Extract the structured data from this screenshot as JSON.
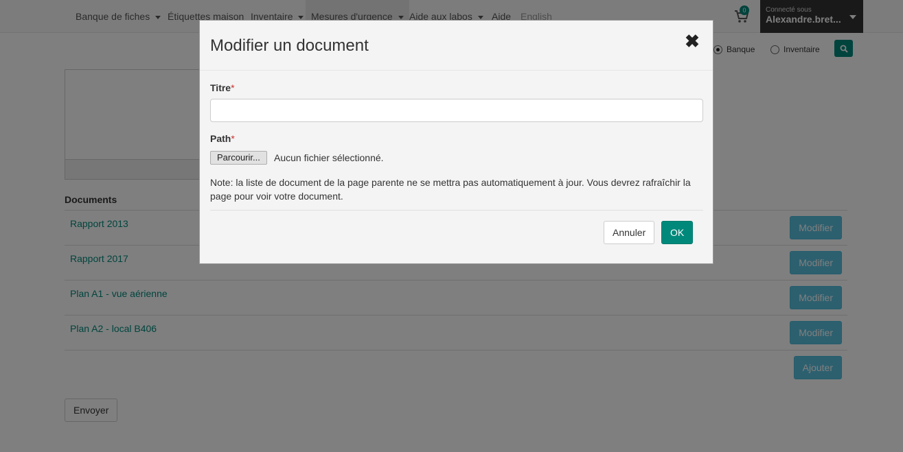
{
  "navbar": {
    "items": [
      {
        "label": "Banque de fiches",
        "dropdown": true
      },
      {
        "label": "Étiquettes maison",
        "dropdown": false
      },
      {
        "label": "Inventaire",
        "dropdown": true
      },
      {
        "label": "Mesures d'urgence",
        "dropdown": true
      },
      {
        "label": "Aide aux labos",
        "dropdown": true
      },
      {
        "label": "Aide",
        "dropdown": false
      },
      {
        "label": "English",
        "dropdown": false
      }
    ],
    "cart_count": "0",
    "user": {
      "connected_label": "Connecté sous",
      "name": "Alexandre.bret..."
    }
  },
  "search": {
    "options": [
      {
        "label": "Banque",
        "checked": true
      },
      {
        "label": "Inventaire",
        "checked": false
      }
    ]
  },
  "documents": {
    "title": "Documents",
    "items": [
      {
        "name": "Rapport 2013",
        "action": "Modifier"
      },
      {
        "name": "Rapport 2017",
        "action": "Modifier"
      },
      {
        "name": "Plan A1 - vue aérienne",
        "action": "Modifier"
      },
      {
        "name": "Plan A2 - local B406",
        "action": "Modifier"
      }
    ],
    "add_label": "Ajouter"
  },
  "send_label": "Envoyer",
  "modal": {
    "title": "Modifier un document",
    "close_symbol": "✖",
    "fields": {
      "title_label": "Titre",
      "title_value": "",
      "path_label": "Path",
      "required_marker": "*",
      "browse_label": "Parcourir...",
      "file_status": "Aucun fichier sélectionné."
    },
    "note": "Note: la liste de document de la page parente ne se mettra pas automatiquement à jour. Vous devrez rafraîchir la page pour voir votre document.",
    "cancel_label": "Annuler",
    "ok_label": "OK"
  },
  "colors": {
    "accent": "#00897b",
    "info": "#5bc0de",
    "backdrop": "rgba(0,0,0,0.5)"
  }
}
